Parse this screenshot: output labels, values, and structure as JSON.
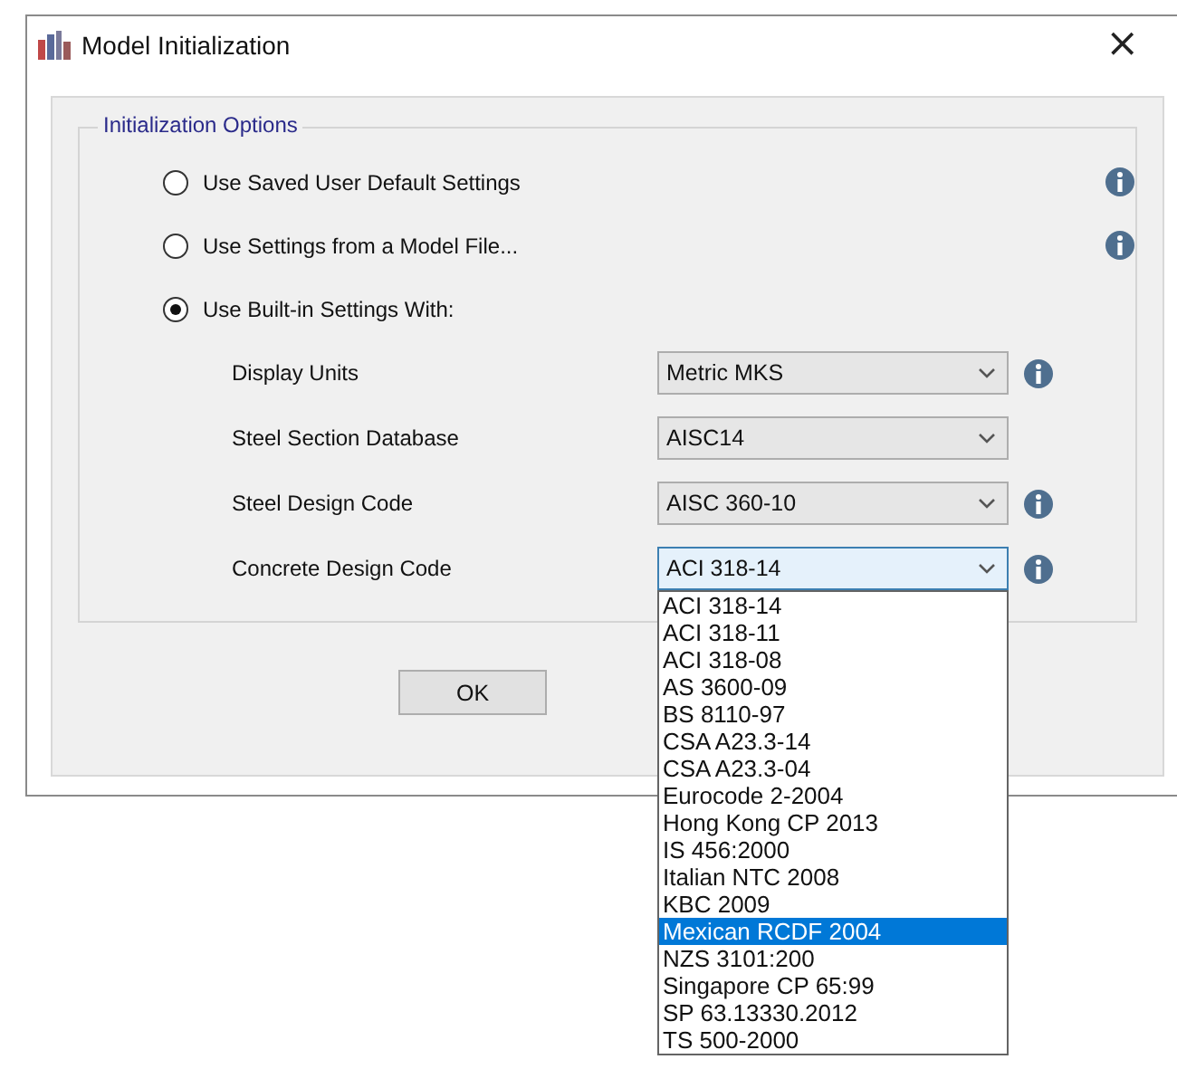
{
  "window": {
    "title": "Model Initialization",
    "close": "×"
  },
  "group": {
    "label": "Initialization Options"
  },
  "options": [
    {
      "label": "Use Saved User Default Settings",
      "selected": false,
      "info": true
    },
    {
      "label": "Use Settings from a Model File...",
      "selected": false,
      "info": true
    },
    {
      "label": "Use Built-in Settings With:",
      "selected": true,
      "info": false
    }
  ],
  "settings": [
    {
      "label": "Display Units",
      "value": "Metric MKS",
      "info": true,
      "expanded": false
    },
    {
      "label": "Steel Section Database",
      "value": "AISC14",
      "info": false,
      "expanded": false
    },
    {
      "label": "Steel Design Code",
      "value": "AISC 360-10",
      "info": true,
      "expanded": false
    },
    {
      "label": "Concrete Design Code",
      "value": "ACI 318-14",
      "info": true,
      "expanded": true
    }
  ],
  "dropdown_items": [
    {
      "label": "ACI 318-14",
      "selected": false
    },
    {
      "label": "ACI 318-11",
      "selected": false
    },
    {
      "label": "ACI 318-08",
      "selected": false
    },
    {
      "label": "AS 3600-09",
      "selected": false
    },
    {
      "label": "BS 8110-97",
      "selected": false
    },
    {
      "label": "CSA A23.3-14",
      "selected": false
    },
    {
      "label": "CSA A23.3-04",
      "selected": false
    },
    {
      "label": "Eurocode 2-2004",
      "selected": false
    },
    {
      "label": "Hong Kong CP 2013",
      "selected": false
    },
    {
      "label": "IS 456:2000",
      "selected": false
    },
    {
      "label": "Italian NTC 2008",
      "selected": false
    },
    {
      "label": "KBC 2009",
      "selected": false
    },
    {
      "label": "Mexican RCDF 2004",
      "selected": true
    },
    {
      "label": "NZS 3101:200",
      "selected": false
    },
    {
      "label": "Singapore CP 65:99",
      "selected": false
    },
    {
      "label": "SP 63.13330.2012",
      "selected": false
    },
    {
      "label": "TS 500-2000",
      "selected": false
    }
  ],
  "ok_button": "OK"
}
